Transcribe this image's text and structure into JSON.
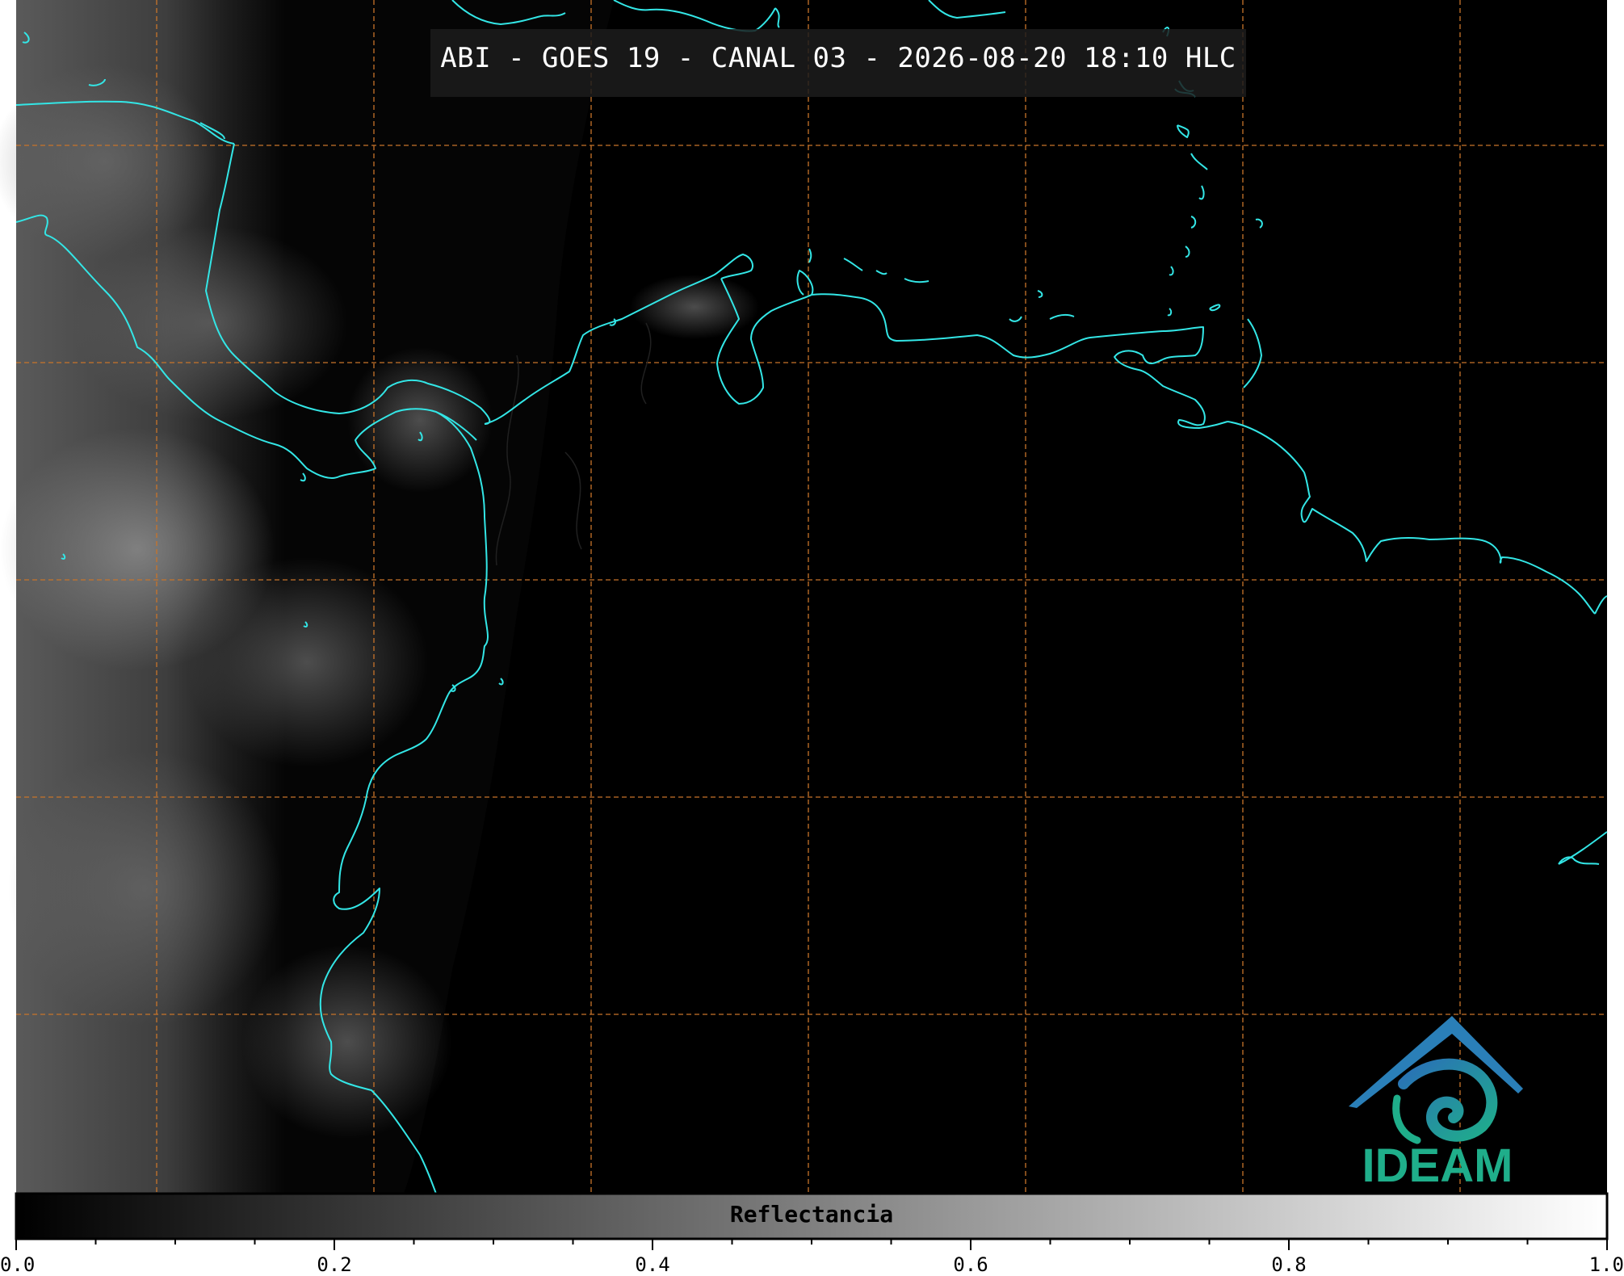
{
  "title": "ABI - GOES 19 - CANAL 03 - 2026-08-20 18:10 HLC",
  "colorbar": {
    "label": "Reflectancia",
    "ticks": [
      "0.0",
      "0.2",
      "0.4",
      "0.6",
      "0.8",
      "1.0"
    ],
    "range": [
      0.0,
      1.0
    ]
  },
  "logo": {
    "text": "IDEAM",
    "color": "#1fae8a",
    "accent": "#2a7fb8"
  },
  "colors": {
    "coastline": "#33e6e6",
    "graticule": "#c8742a",
    "background": "#000000"
  }
}
